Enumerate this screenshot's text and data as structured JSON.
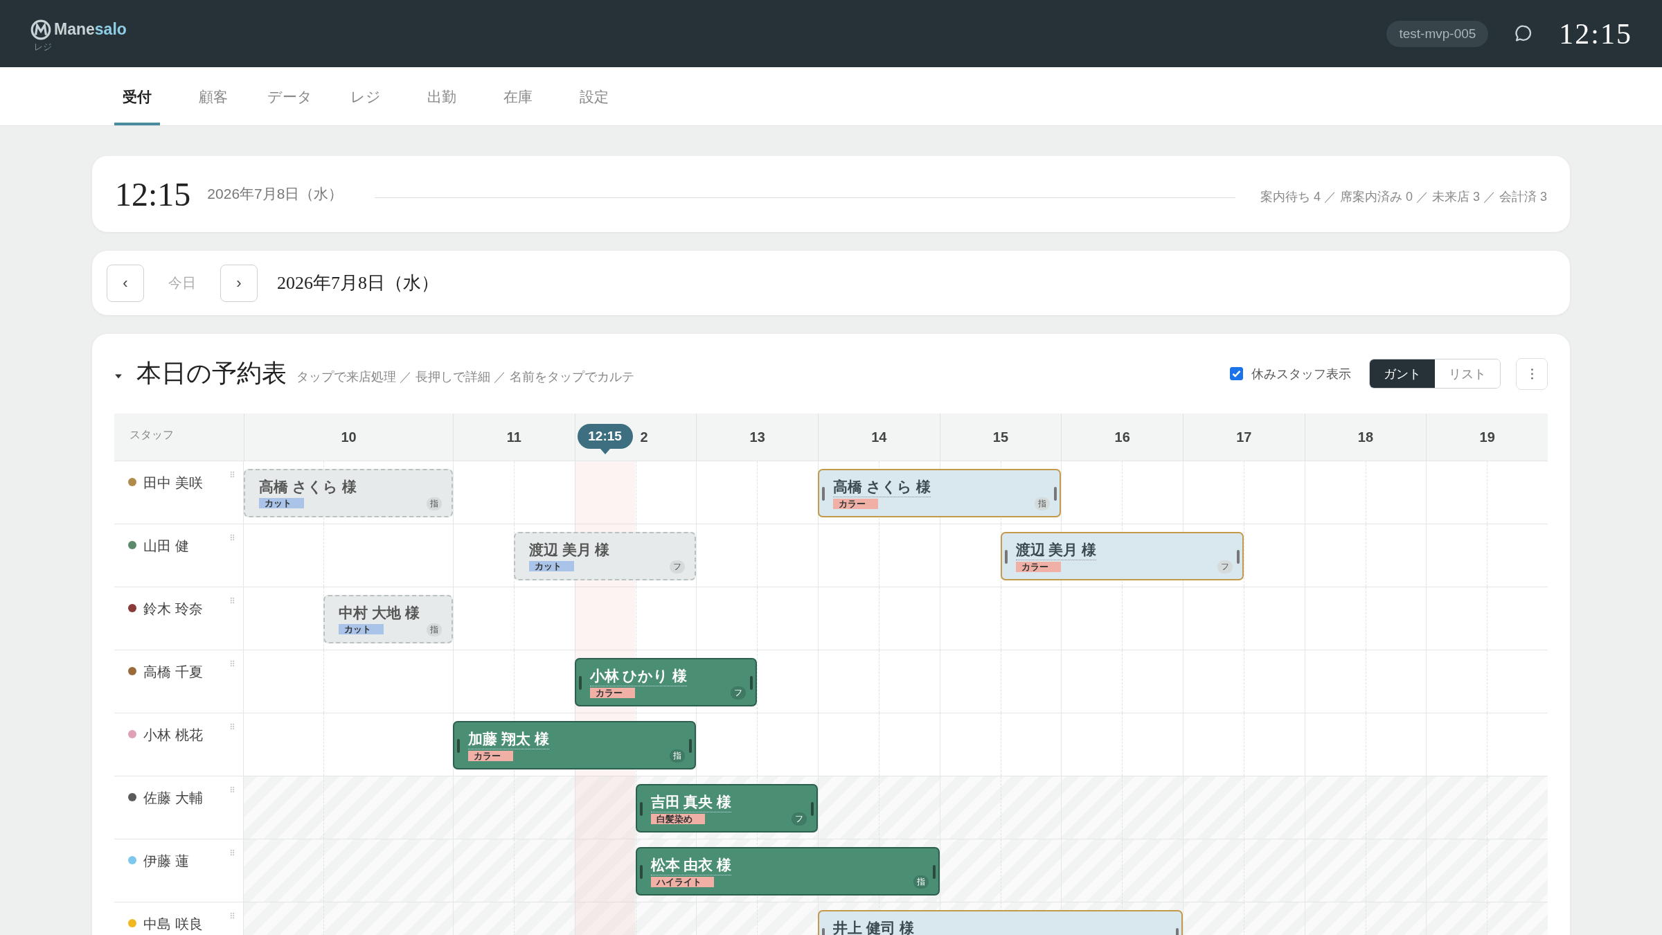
{
  "header": {
    "brand": {
      "name_start": "Mane",
      "name_end": "salo",
      "subtitle": "レジ"
    },
    "store_badge": "test-mvp-005",
    "clock": "12:15"
  },
  "tabs": [
    {
      "label": "受付",
      "selected": true
    },
    {
      "label": "顧客",
      "selected": false
    },
    {
      "label": "データ",
      "selected": false
    },
    {
      "label": "レジ",
      "selected": false
    },
    {
      "label": "出勤",
      "selected": false
    },
    {
      "label": "在庫",
      "selected": false
    },
    {
      "label": "設定",
      "selected": false
    }
  ],
  "summary": {
    "time": "12:15",
    "date": "2026年7月8日（水）",
    "stats": "案内待ち 4 ／ 席案内済み 0 ／ 未来店 3 ／ 会計済 3"
  },
  "date_nav": {
    "prev": "‹",
    "today": "今日",
    "next": "›",
    "date": "2026年7月8日（水）"
  },
  "schedule": {
    "expanded": true,
    "title": "本日の予約表",
    "hint": "タップで来店処理 ／ 長押しで詳細 ／ 名前をタップでカルテ",
    "show_off_staff": {
      "label": "休みスタッフ表示",
      "checked": true
    },
    "views": [
      {
        "label": "ガント",
        "selected": true
      },
      {
        "label": "リスト",
        "selected": false
      }
    ],
    "staff_header": "スタッフ",
    "hours": [
      "10",
      "11",
      "2",
      "13",
      "14",
      "15",
      "16",
      "17",
      "18",
      "19"
    ],
    "now": "12:15",
    "rows": [
      {
        "name": "田中 美咲",
        "color": "#b08a4a",
        "off": false,
        "bookings": [
          {
            "name": "高橋 さくら 様",
            "kind": "past",
            "tag": {
              "label": "カット",
              "color": "#a9c4e8"
            },
            "mark": "指"
          },
          {
            "name": "高橋 さくら 様",
            "kind": "reserved",
            "tag": {
              "label": "カラー",
              "color": "#f0b0a6"
            },
            "mark": "指"
          }
        ]
      },
      {
        "name": "山田 健",
        "color": "#5b8a6a",
        "off": false,
        "bookings": [
          {
            "name": "渡辺 美月 様",
            "kind": "past",
            "tag": {
              "label": "カット",
              "color": "#a9c4e8"
            },
            "mark": "フ"
          },
          {
            "name": "渡辺 美月 様",
            "kind": "reserved",
            "tag": {
              "label": "カラー",
              "color": "#f0b0a6"
            },
            "mark": "フ"
          }
        ]
      },
      {
        "name": "鈴木 玲奈",
        "color": "#8b3a3a",
        "off": false,
        "bookings": [
          {
            "name": "中村 大地 様",
            "kind": "past",
            "tag": {
              "label": "カット",
              "color": "#a9c4e8"
            },
            "mark": "指"
          }
        ]
      },
      {
        "name": "高橋 千夏",
        "color": "#9a6a3a",
        "off": false,
        "bookings": [
          {
            "name": "小林 ひかり 様",
            "kind": "in_service",
            "tag": {
              "label": "カラー",
              "color": "#f0b0a6"
            },
            "mark": "フ"
          }
        ]
      },
      {
        "name": "小林 桃花",
        "color": "#e0a0b8",
        "off": false,
        "bookings": [
          {
            "name": "加藤 翔太 様",
            "kind": "in_service",
            "tag": {
              "label": "カラー",
              "color": "#f0b0a6"
            },
            "mark": "指"
          }
        ]
      },
      {
        "name": "佐藤 大輔",
        "color": "#5a5a5a",
        "off": true,
        "bookings": [
          {
            "name": "吉田 真央 様",
            "kind": "in_service",
            "tag": {
              "label": "白髪染め",
              "color": "#f0b0a6"
            },
            "mark": "フ"
          }
        ]
      },
      {
        "name": "伊藤 蓮",
        "color": "#7ec8ee",
        "off": true,
        "bookings": [
          {
            "name": "松本 由衣 様",
            "kind": "in_service",
            "tag": {
              "label": "ハイライト",
              "color": "#f0b0a6"
            },
            "mark": "指"
          }
        ]
      },
      {
        "name": "中島 咲良",
        "color": "#f0b820",
        "off": true,
        "bookings": [
          {
            "name": "井上 健司 様",
            "kind": "reserved"
          }
        ]
      }
    ]
  }
}
